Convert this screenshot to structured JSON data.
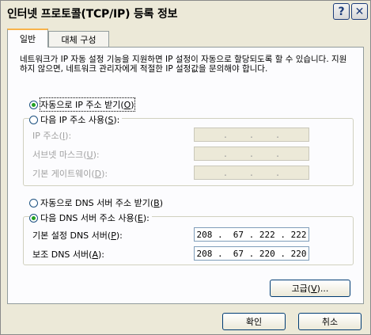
{
  "window": {
    "title": "인터넷 프로토콜(TCP/IP) 등록 정보"
  },
  "titlebar": {
    "help_glyph": "?",
    "close_glyph": "✕"
  },
  "tabs": [
    {
      "label": "일반"
    },
    {
      "label": "대체 구성"
    }
  ],
  "description": "네트워크가 IP 자동 설정 기능을 지원하면 IP 설정이 자동으로 할당되도록 할 수 있습니다. 지원하지 않으면, 네트워크 관리자에게 적절한 IP 설정값을 문의해야 합니다.",
  "ip_section": {
    "auto_radio": {
      "text": "자동으로 IP 주소 받기(",
      "key": "O",
      "close": ")",
      "checked": true
    },
    "manual_radio": {
      "text": "다음 IP 주소 사용(",
      "key": "S",
      "close": "):",
      "checked": false
    },
    "fields": [
      {
        "text": "IP 주소(",
        "key": "I",
        "close": "):",
        "value": "   .    .    .   "
      },
      {
        "text": "서브넷 마스크(",
        "key": "U",
        "close": "):",
        "value": "   .    .    .   "
      },
      {
        "text": "기본 게이트웨이(",
        "key": "D",
        "close": "):",
        "value": "   .    .    .   "
      }
    ]
  },
  "dns_section": {
    "auto_radio": {
      "text": "자동으로 DNS 서버 주소 받기(",
      "key": "B",
      "close": ")",
      "checked": false
    },
    "manual_radio": {
      "text": "다음 DNS 서버 주소 사용(",
      "key": "E",
      "close": "):",
      "checked": true
    },
    "fields": [
      {
        "text": "기본 설정 DNS 서버(",
        "key": "P",
        "close": "):",
        "value": "208 .  67 . 222 . 222"
      },
      {
        "text": "보조 DNS 서버(",
        "key": "A",
        "close": "):",
        "value": "208 .  67 . 220 . 220"
      }
    ]
  },
  "advanced_button": {
    "text": "고급(",
    "key": "V",
    "close": ")..."
  },
  "ok_button": "확인",
  "cancel_button": "취소",
  "colors": {
    "window_bg": "#ece9d8",
    "border": "#003c74",
    "tab_highlight": "#f8b34a",
    "radio_dot": "#21a121"
  }
}
